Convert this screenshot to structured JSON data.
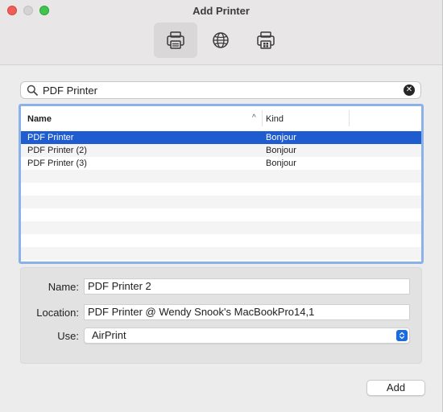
{
  "window": {
    "title": "Add Printer"
  },
  "toolbar": {
    "items": [
      {
        "icon": "default-printer-icon",
        "active": true
      },
      {
        "icon": "ip-globe-icon",
        "active": false
      },
      {
        "icon": "windows-printer-icon",
        "active": false
      }
    ]
  },
  "search": {
    "value": "PDF Printer",
    "placeholder": "Search"
  },
  "table": {
    "headers": {
      "name": "Name",
      "kind": "Kind"
    },
    "rows": [
      {
        "name": "PDF Printer",
        "kind": "Bonjour",
        "selected": true
      },
      {
        "name": "PDF Printer (2)",
        "kind": "Bonjour",
        "selected": false
      },
      {
        "name": "PDF Printer (3)",
        "kind": "Bonjour",
        "selected": false
      }
    ],
    "empty_rows": 7
  },
  "form": {
    "name_label": "Name:",
    "name_value": "PDF Printer 2",
    "location_label": "Location:",
    "location_value": "PDF Printer @ Wendy Snook's MacBookPro14,1",
    "use_label": "Use:",
    "use_value": "AirPrint"
  },
  "actions": {
    "add_label": "Add"
  },
  "colors": {
    "selection": "#1e5ccf",
    "focus_ring": "#8ab2e8",
    "stepper": "#1c6bdf"
  }
}
